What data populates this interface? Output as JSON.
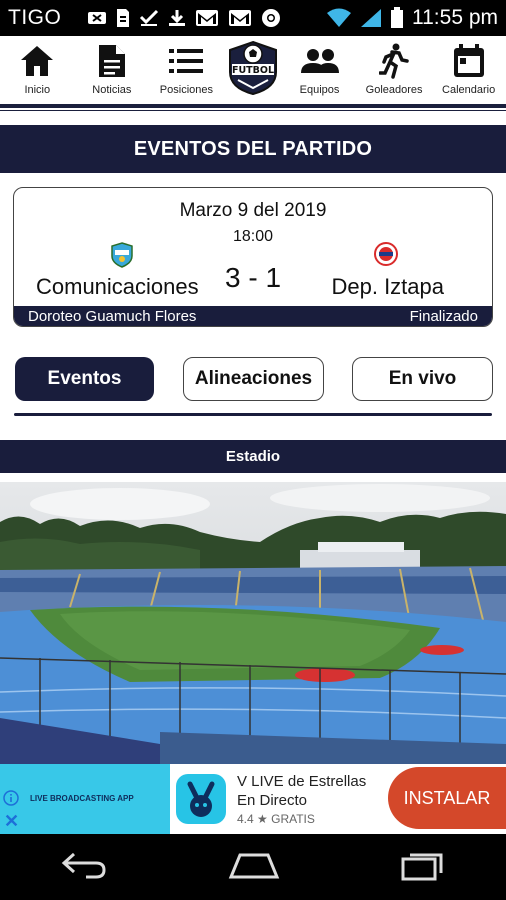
{
  "status_bar": {
    "carrier": "TIGO",
    "time": "11:55 pm"
  },
  "nav": {
    "items": [
      {
        "label": "Inicio",
        "icon": "home-icon"
      },
      {
        "label": "Noticias",
        "icon": "document-icon"
      },
      {
        "label": "Posiciones",
        "icon": "list-icon"
      },
      {
        "label": "Equipos",
        "icon": "people-icon"
      },
      {
        "label": "Goleadores",
        "icon": "runner-icon"
      },
      {
        "label": "Calendario",
        "icon": "calendar-icon"
      }
    ],
    "logo_text": "FUTBOL"
  },
  "page": {
    "title": "EVENTOS DEL PARTIDO"
  },
  "match": {
    "date": "Marzo 9 del 2019",
    "time": "18:00",
    "home_team": "Comunicaciones",
    "away_team": "Dep. Iztapa",
    "score": "3 - 1",
    "stadium": "Doroteo Guamuch Flores",
    "status": "Finalizado"
  },
  "tabs": [
    {
      "label": "Eventos",
      "active": true
    },
    {
      "label": "Alineaciones",
      "active": false
    },
    {
      "label": "En vivo",
      "active": false
    }
  ],
  "stadium_section": {
    "title": "Estadio"
  },
  "ad": {
    "left_text": "LIVE BROADCASTING APP",
    "title": "V LIVE de Estrellas",
    "subtitle": "En Directo",
    "rating": "4.4 ★ GRATIS",
    "install_label": "INSTALAR"
  },
  "colors": {
    "navy": "#191d3c",
    "ad_cyan": "#38c8e8",
    "install_red": "#d4482a"
  }
}
